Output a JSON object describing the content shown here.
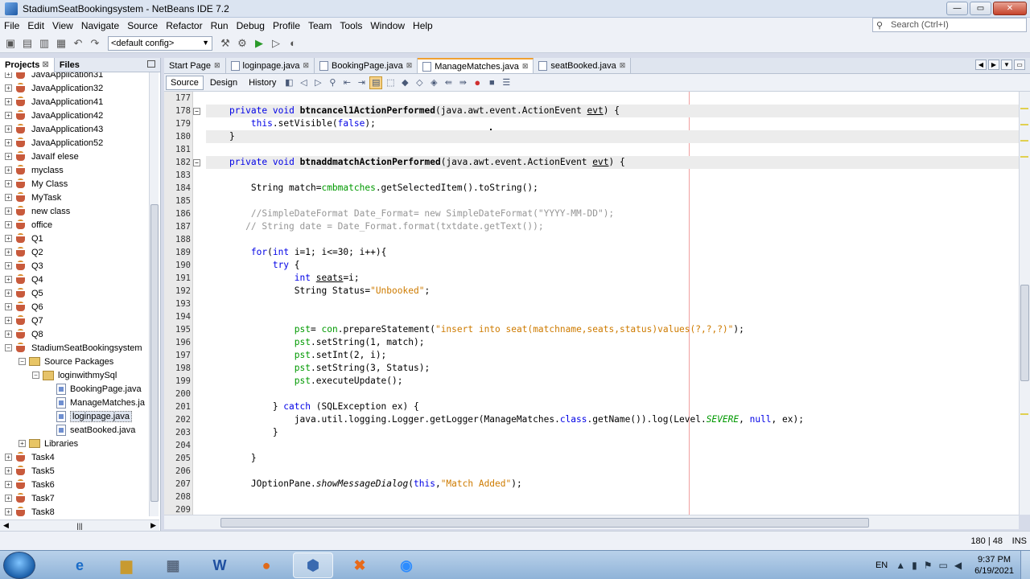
{
  "window": {
    "title": "StadiumSeatBookingsystem - NetBeans IDE 7.2"
  },
  "menu": [
    "File",
    "Edit",
    "View",
    "Navigate",
    "Source",
    "Refactor",
    "Run",
    "Debug",
    "Profile",
    "Team",
    "Tools",
    "Window",
    "Help"
  ],
  "search": {
    "placeholder": "Search (Ctrl+I)"
  },
  "toolbar": {
    "config": "<default config>"
  },
  "panel": {
    "tab_projects": "Projects",
    "tab_files": "Files"
  },
  "tree": [
    {
      "label": "JavaApplication31",
      "type": "project"
    },
    {
      "label": "JavaApplication32",
      "type": "project"
    },
    {
      "label": "JavaApplication41",
      "type": "project"
    },
    {
      "label": "JavaApplication42",
      "type": "project"
    },
    {
      "label": "JavaApplication43",
      "type": "project"
    },
    {
      "label": "JavaApplication52",
      "type": "project"
    },
    {
      "label": "JavaIf elese",
      "type": "project"
    },
    {
      "label": "myclass",
      "type": "project"
    },
    {
      "label": "My Class",
      "type": "project"
    },
    {
      "label": "MyTask",
      "type": "project"
    },
    {
      "label": "new class",
      "type": "project"
    },
    {
      "label": "office",
      "type": "project"
    },
    {
      "label": "Q1",
      "type": "project"
    },
    {
      "label": "Q2",
      "type": "project"
    },
    {
      "label": "Q3",
      "type": "project"
    },
    {
      "label": "Q4",
      "type": "project"
    },
    {
      "label": "Q5",
      "type": "project"
    },
    {
      "label": "Q6",
      "type": "project"
    },
    {
      "label": "Q7",
      "type": "project"
    },
    {
      "label": "Q8",
      "type": "project"
    },
    {
      "label": "StadiumSeatBookingsystem",
      "type": "project",
      "expanded": true
    },
    {
      "label": "Source Packages",
      "type": "folder",
      "indent": 1,
      "expanded": true
    },
    {
      "label": "loginwithmySql",
      "type": "package",
      "indent": 2,
      "expanded": true
    },
    {
      "label": "BookingPage.java",
      "type": "file",
      "indent": 3
    },
    {
      "label": "ManageMatches.ja",
      "type": "file",
      "indent": 3
    },
    {
      "label": "loginpage.java",
      "type": "file",
      "indent": 3,
      "selected": true
    },
    {
      "label": "seatBooked.java",
      "type": "file",
      "indent": 3
    },
    {
      "label": "Libraries",
      "type": "folder",
      "indent": 1
    },
    {
      "label": "Task4",
      "type": "project"
    },
    {
      "label": "Task5",
      "type": "project"
    },
    {
      "label": "Task6",
      "type": "project"
    },
    {
      "label": "Task7",
      "type": "project"
    },
    {
      "label": "Task8",
      "type": "project"
    }
  ],
  "editor_tabs": [
    {
      "label": "Start Page",
      "active": false
    },
    {
      "label": "loginpage.java",
      "active": false
    },
    {
      "label": "BookingPage.java",
      "active": false
    },
    {
      "label": "ManageMatches.java",
      "active": true
    },
    {
      "label": "seatBooked.java",
      "active": false
    }
  ],
  "editor_modes": {
    "source": "Source",
    "design": "Design",
    "history": "History"
  },
  "code": [
    {
      "n": "177",
      "html": ""
    },
    {
      "n": "178",
      "fold": "-",
      "guarded": true,
      "html": "    <span class='kw'>private</span> <span class='kw'>void</span> <span class='b'>btncancel1ActionPerformed</span>(java.awt.event.ActionEvent <u>evt</u>) {"
    },
    {
      "n": "179",
      "guarded": false,
      "html": "        <span class='kw'>this</span>.setVisible(<span class='kw'>false</span>);"
    },
    {
      "n": "180",
      "guarded": true,
      "html": "    }"
    },
    {
      "n": "181",
      "html": ""
    },
    {
      "n": "182",
      "fold": "-",
      "guarded": true,
      "html": "    <span class='kw'>private</span> <span class='kw'>void</span> <span class='b'>btnaddmatchActionPerformed</span>(java.awt.event.ActionEvent <u>evt</u>) {"
    },
    {
      "n": "183",
      "html": ""
    },
    {
      "n": "184",
      "html": "        String match=<span class='fld'>cmbmatches</span>.getSelectedItem().toString();"
    },
    {
      "n": "185",
      "html": ""
    },
    {
      "n": "186",
      "html": "        <span class='cmt'>//SimpleDateFormat Date_Format= new SimpleDateFormat(\"YYYY-MM-DD\");</span>"
    },
    {
      "n": "187",
      "html": "       <span class='cmt'>// String date = Date_Format.format(txtdate.getText());</span>"
    },
    {
      "n": "188",
      "html": ""
    },
    {
      "n": "189",
      "html": "        <span class='kw'>for</span>(<span class='kw'>int</span> i=1; i&lt;=30; i++){"
    },
    {
      "n": "190",
      "html": "            <span class='kw'>try</span> {"
    },
    {
      "n": "191",
      "html": "                <span class='kw'>int</span> <u>seats</u>=i;"
    },
    {
      "n": "192",
      "html": "                String Status=<span class='str'>\"Unbooked\"</span>;"
    },
    {
      "n": "193",
      "html": ""
    },
    {
      "n": "194",
      "html": ""
    },
    {
      "n": "195",
      "html": "                <span class='fld'>pst</span>= <span class='fld'>con</span>.prepareStatement(<span class='str'>\"insert into seat(matchname,seats,status)values(?,?,?)\"</span>);"
    },
    {
      "n": "196",
      "html": "                <span class='fld'>pst</span>.setString(1, match);"
    },
    {
      "n": "197",
      "html": "                <span class='fld'>pst</span>.setInt(2, i);"
    },
    {
      "n": "198",
      "html": "                <span class='fld'>pst</span>.setString(3, Status);"
    },
    {
      "n": "199",
      "html": "                <span class='fld'>pst</span>.executeUpdate();"
    },
    {
      "n": "200",
      "html": ""
    },
    {
      "n": "201",
      "html": "            } <span class='kw'>catch</span> (SQLException ex) {"
    },
    {
      "n": "202",
      "html": "                java.util.logging.Logger.getLogger(ManageMatches.<span class='kw'>class</span>.getName()).log(Level.<span class='fld ital'>SEVERE</span>, <span class='kw'>null</span>, ex);"
    },
    {
      "n": "203",
      "html": "            }"
    },
    {
      "n": "204",
      "html": ""
    },
    {
      "n": "205",
      "html": "        }"
    },
    {
      "n": "206",
      "html": ""
    },
    {
      "n": "207",
      "html": "        JOptionPane.<span class='ital'>showMessageDialog</span>(<span class='kw'>this</span>,<span class='str'>\"Match Added\"</span>);"
    },
    {
      "n": "208",
      "html": ""
    },
    {
      "n": "209",
      "html": ""
    }
  ],
  "status": {
    "position": "180 | 48",
    "mode": "INS"
  },
  "taskbar": {
    "lang": "EN",
    "time": "9:37 PM",
    "date": "6/19/2021"
  }
}
